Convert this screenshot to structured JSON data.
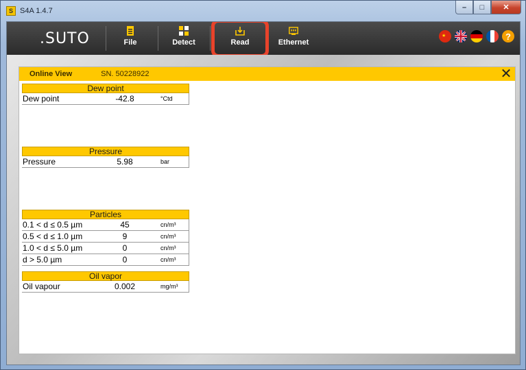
{
  "window": {
    "title": "S4A  1.4.7",
    "app_icon_letter": "S",
    "controls": {
      "minimize": "–",
      "maximize": "□",
      "close": "✕"
    }
  },
  "toolbar": {
    "logo": ".SUTO",
    "buttons": [
      {
        "label": "File",
        "icon": "file-icon"
      },
      {
        "label": "Detect",
        "icon": "detect-icon"
      },
      {
        "label": "Read",
        "icon": "read-icon"
      },
      {
        "label": "Ethernet",
        "icon": "ethernet-icon"
      }
    ],
    "languages": [
      "chinese-flag",
      "uk-flag",
      "german-flag",
      "french-flag"
    ],
    "help": "?"
  },
  "panel": {
    "title": "Online View",
    "serial": "SN. 50228922",
    "close": "✕",
    "sections": [
      {
        "header": "Dew point",
        "rows": [
          {
            "label": "Dew point",
            "value": "-42.8",
            "unit": "°Ctd"
          }
        ]
      },
      {
        "header": "Pressure",
        "rows": [
          {
            "label": "Pressure",
            "value": "5.98",
            "unit": "bar"
          }
        ]
      },
      {
        "header": "Particles",
        "rows": [
          {
            "label": "0.1 < d ≤ 0.5 µm",
            "value": "45",
            "unit": "cn/m³"
          },
          {
            "label": "0.5 < d ≤ 1.0 µm",
            "value": "9",
            "unit": "cn/m³"
          },
          {
            "label": "1.0 < d ≤ 5.0 µm",
            "value": "0",
            "unit": "cn/m³"
          },
          {
            "label": "d > 5.0 µm",
            "value": "0",
            "unit": "cn/m³"
          }
        ]
      },
      {
        "header": "Oil vapor",
        "rows": [
          {
            "label": "Oil vapour",
            "value": "0.002",
            "unit": "mg/m³"
          }
        ]
      }
    ]
  },
  "colors": {
    "accent": "#ffc800",
    "toolbar": "#333333",
    "highlight": "#e8432b"
  }
}
